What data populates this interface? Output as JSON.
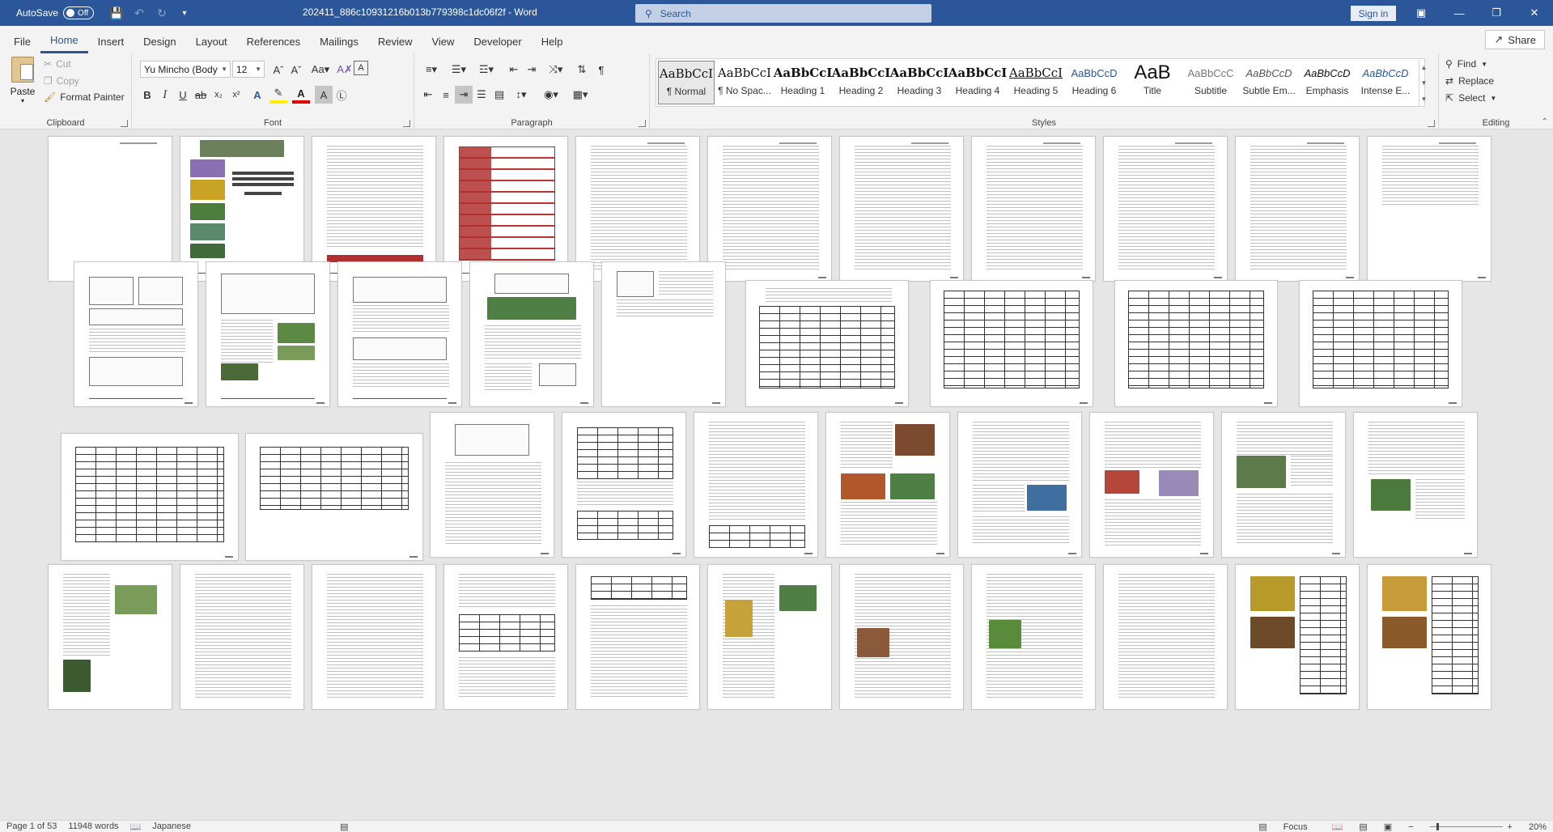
{
  "titlebar": {
    "autosave_label": "AutoSave",
    "autosave_state": "Off",
    "document_title": "202411_886c10931216b013b779398c1dc06f2f  -  Word",
    "search_placeholder": "Search",
    "signin_label": "Sign in"
  },
  "menu": {
    "tabs": [
      "File",
      "Home",
      "Insert",
      "Design",
      "Layout",
      "References",
      "Mailings",
      "Review",
      "View",
      "Developer",
      "Help"
    ],
    "active": "Home",
    "share_label": "Share"
  },
  "ribbon": {
    "clipboard": {
      "label": "Clipboard",
      "paste": "Paste",
      "cut": "Cut",
      "copy": "Copy",
      "format_painter": "Format Painter"
    },
    "font": {
      "label": "Font",
      "font_name": "Yu Mincho (Body",
      "font_size": "12"
    },
    "paragraph": {
      "label": "Paragraph"
    },
    "styles": {
      "label": "Styles",
      "items": [
        {
          "sample": "AaBbCcI",
          "name": "¶ Normal"
        },
        {
          "sample": "AaBbCcI",
          "name": "¶ No Spac..."
        },
        {
          "sample": "AaBbCcI",
          "name": "Heading 1"
        },
        {
          "sample": "AaBbCcI",
          "name": "Heading 2"
        },
        {
          "sample": "AaBbCcI",
          "name": "Heading 3"
        },
        {
          "sample": "AaBbCcI",
          "name": "Heading 4"
        },
        {
          "sample": "AaBbCcI",
          "name": "Heading 5"
        },
        {
          "sample": "AaBbCcD",
          "name": "Heading 6"
        },
        {
          "sample": "AaB",
          "name": "Title"
        },
        {
          "sample": "AaBbCcC",
          "name": "Subtitle"
        },
        {
          "sample": "AaBbCcD",
          "name": "Subtle Em..."
        },
        {
          "sample": "AaBbCcD",
          "name": "Emphasis"
        },
        {
          "sample": "AaBbCcD",
          "name": "Intense E..."
        }
      ]
    },
    "editing": {
      "label": "Editing",
      "find": "Find",
      "replace": "Replace",
      "select": "Select"
    }
  },
  "status": {
    "page": "Page 1 of 53",
    "words": "11948 words",
    "language": "Japanese",
    "focus": "Focus",
    "zoom": "20%"
  },
  "colors": {
    "accent": "#2b579a",
    "ribbon_bg": "#f3f3f3",
    "canvas_bg": "#e6e6e6"
  }
}
